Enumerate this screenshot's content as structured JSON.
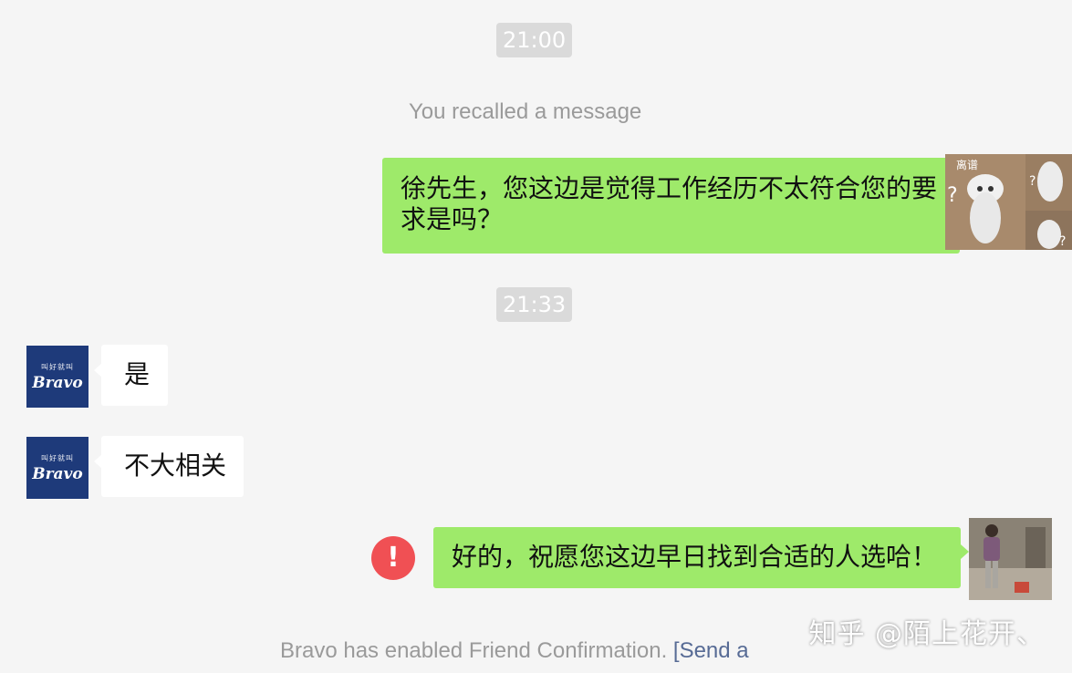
{
  "chat": {
    "timestamps": [
      "21:00",
      "21:33"
    ],
    "recalled_notice": "You recalled a message",
    "messages": [
      {
        "sender": "me",
        "text": "徐先生，您这边是觉得工作经历不太符合您的要求是吗？"
      },
      {
        "sender": "Bravo",
        "text": "是"
      },
      {
        "sender": "Bravo",
        "text": "不大相关"
      },
      {
        "sender": "me",
        "text": "好的，祝愿您这边早日找到合适的人选哈！",
        "status": "failed"
      }
    ],
    "friend_confirmation": {
      "text": "Bravo has enabled Friend Confirmation. ",
      "link": "[Send a"
    },
    "error_icon_glyph": "!"
  },
  "avatars": {
    "bravo": {
      "small_text": "叫好就叫",
      "brand": "Bravo"
    },
    "me_1": {
      "sticker_text": "离谱"
    }
  },
  "watermark": "知乎 @陌上花开、",
  "colors": {
    "background": "#f5f5f5",
    "my_bubble": "#9eea6a",
    "their_bubble": "#ffffff",
    "timestamp_bg": "#dadada",
    "error": "#f05054",
    "bravo_avatar": "#1e3a7a",
    "link": "#576b95"
  }
}
